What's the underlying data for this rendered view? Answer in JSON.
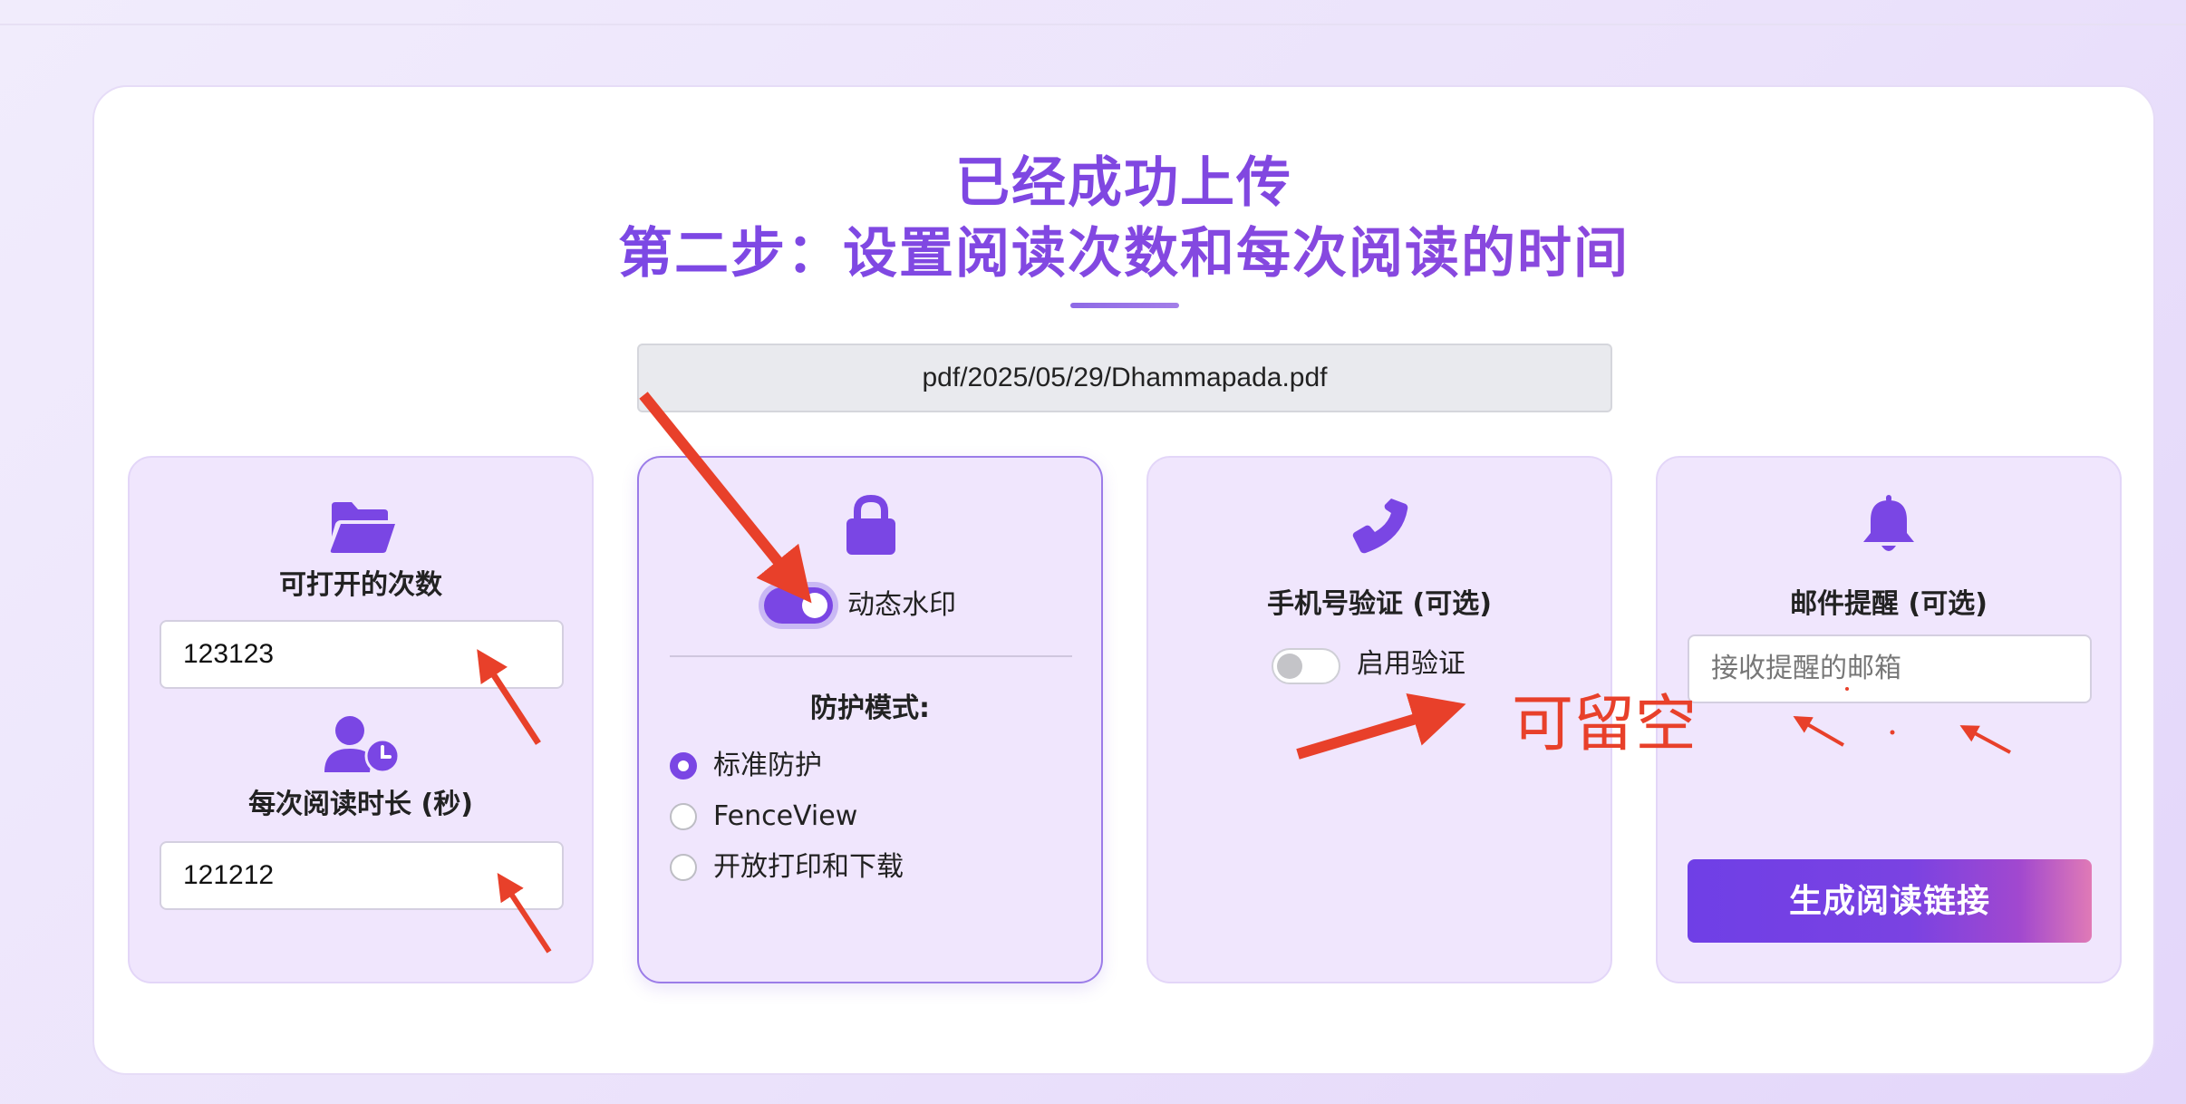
{
  "header": {
    "title_line1": "已经成功上传",
    "title_line2": "第二步：设置阅读次数和每次阅读的时间"
  },
  "file": {
    "path": "pdf/2025/05/29/Dhammapada.pdf"
  },
  "card_open_count": {
    "icon": "folder-open-icon",
    "label": "可打开的次数",
    "value": "123123"
  },
  "card_duration": {
    "icon": "user-clock-icon",
    "label": "每次阅读时长 (秒)",
    "value": "121212"
  },
  "card_watermark": {
    "icon": "lock-icon",
    "toggle_label": "动态水印",
    "toggle_on": true,
    "mode_heading": "防护模式:",
    "options": [
      {
        "label": "标准防护",
        "selected": true
      },
      {
        "label": "FenceView",
        "selected": false
      },
      {
        "label": "开放打印和下载",
        "selected": false
      }
    ]
  },
  "card_phone": {
    "icon": "phone-icon",
    "label": "手机号验证 (可选)",
    "toggle_label": "启用验证",
    "toggle_on": false
  },
  "card_email": {
    "icon": "bell-icon",
    "label": "邮件提醒 (可选)",
    "placeholder": "接收提醒的邮箱",
    "value": "",
    "button_label": "生成阅读链接"
  },
  "annotations": {
    "note": "可留空",
    "color": "#e8402a"
  },
  "colors": {
    "accent": "#7a46e4",
    "card_bg": "#f0e6fd",
    "page_bg": "#ebe2fb"
  }
}
